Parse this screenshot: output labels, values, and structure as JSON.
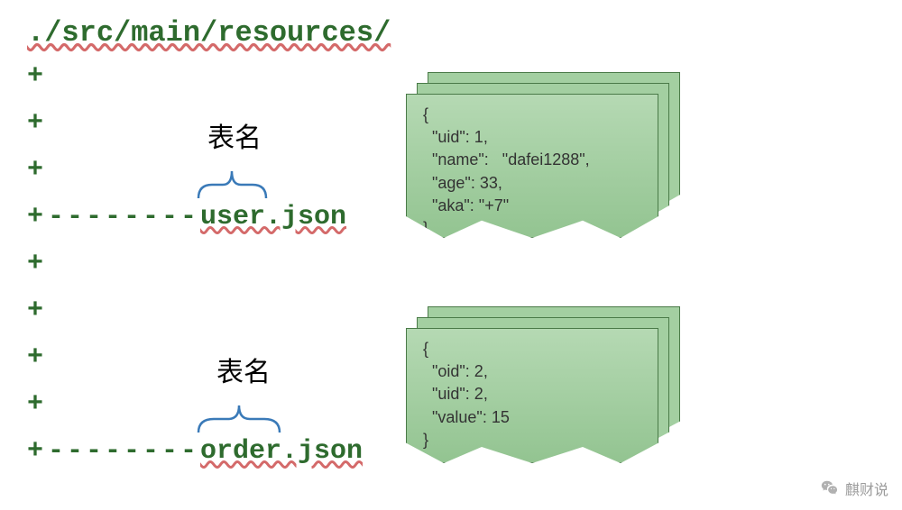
{
  "path": "./src/main/resources/",
  "tree": {
    "plus": "+",
    "dashes": "--------",
    "table_name_label": "表名",
    "file1": "user.json",
    "file2": "order.json"
  },
  "json_card1": "{\n  \"uid\": 1,\n  \"name\":   \"dafei1288\",\n  \"age\": 33,\n  \"aka\": \"+7\"\n}",
  "json_card2": "{\n  \"oid\": 2,\n  \"uid\": 2,\n  \"value\": 15\n}",
  "watermark": "麒财说",
  "colors": {
    "green_text": "#2e6b2e",
    "card_fill": "#a3cfa1",
    "card_border": "#4a7a48",
    "bracket": "#3a7ab8"
  }
}
